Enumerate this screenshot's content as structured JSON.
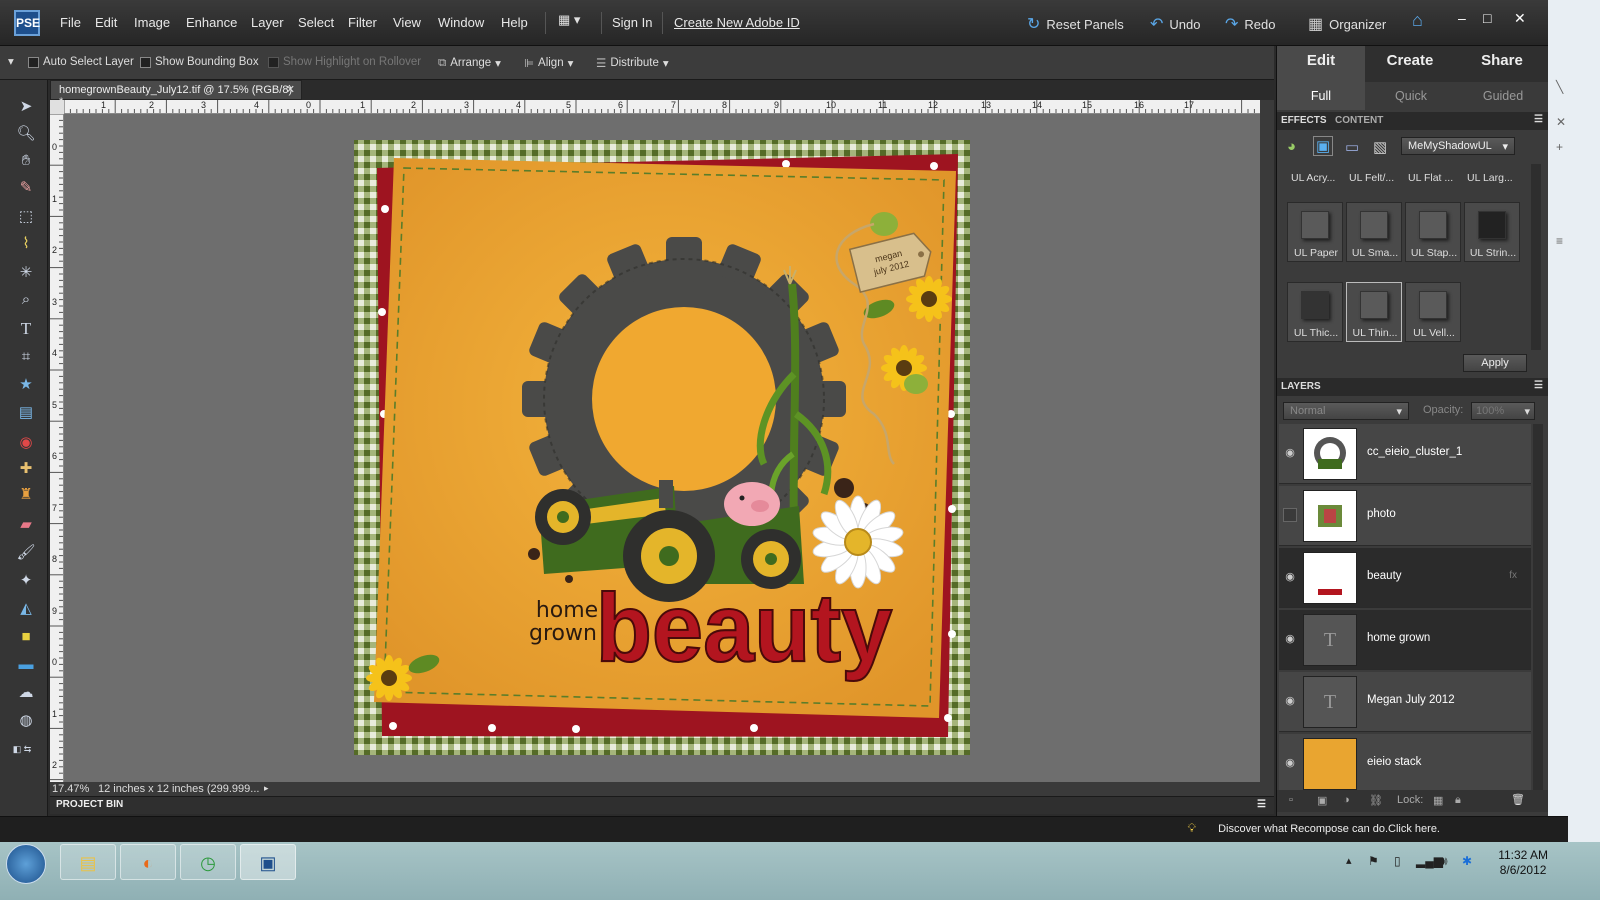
{
  "menubar": {
    "logo_text": "PSE",
    "items": [
      "File",
      "Edit",
      "Image",
      "Enhance",
      "Layer",
      "Select",
      "Filter",
      "View",
      "Window",
      "Help"
    ],
    "sign_in": "Sign In",
    "create_id": "Create New Adobe ID",
    "reset_panels": "Reset Panels",
    "undo": "Undo",
    "redo": "Redo",
    "organizer": "Organizer"
  },
  "options": {
    "auto_select": "Auto Select Layer",
    "show_bounding": "Show Bounding Box",
    "show_highlight": "Show Highlight on Rollover",
    "arrange": "Arrange",
    "align": "Align",
    "distribute": "Distribute"
  },
  "document": {
    "tab_title": "homegrownBeauty_July12.tif @ 17.5% (RGB/8) *",
    "zoom": "17.47%",
    "doc_info": "12 inches x 12 inches (299.999...",
    "project_bin": "PROJECT BIN",
    "ruler_h_labels": [
      "5",
      "6",
      "7",
      "8",
      "9",
      "10",
      "11",
      "12",
      "13",
      "14",
      "15",
      "16",
      "17"
    ],
    "ruler_h_labels_b": [
      "1",
      "2",
      "3",
      "4",
      "0",
      "1",
      "2",
      "3",
      "4"
    ],
    "ruler_v_labels": [
      "0",
      "1",
      "2",
      "3",
      "4",
      "5",
      "6",
      "7",
      "8",
      "9",
      "0",
      "1",
      "2"
    ]
  },
  "artwork": {
    "home_text": "home",
    "grown_text": "grown",
    "beauty_text": "beauty",
    "tag_line1": "megan",
    "tag_line2": "july 2012",
    "colors": {
      "paper": "#f0a830",
      "red_border": "#9e1420",
      "gingham": "#6f8a3c",
      "gear": "#4a4a48",
      "tractor": "#3f6b1e",
      "beauty": "#b3151f"
    }
  },
  "panel": {
    "modes": [
      "Edit",
      "Create",
      "Share"
    ],
    "submodes": [
      "Full",
      "Quick",
      "Guided"
    ],
    "effects_tab": "EFFECTS",
    "content_tab": "CONTENT",
    "style_dropdown": "MeMyShadowUL",
    "fx_row0": [
      "UL Acry...",
      "UL Felt/...",
      "UL Flat ...",
      "UL Larg..."
    ],
    "fx_row1": [
      "UL Paper",
      "UL Sma...",
      "UL Stap...",
      "UL Strin..."
    ],
    "fx_row2": [
      "UL Thic...",
      "UL Thin...",
      "UL Vell..."
    ],
    "apply": "Apply",
    "layers_head": "LAYERS",
    "blend_mode": "Normal",
    "opacity_label": "Opacity:",
    "opacity_value": "100%",
    "lock_label": "Lock:",
    "layers": [
      {
        "name": "cc_eieio_cluster_1",
        "visible": true,
        "selected": false,
        "kind": "cluster"
      },
      {
        "name": "photo",
        "visible": false,
        "selected": false,
        "kind": "photo"
      },
      {
        "name": "beauty",
        "visible": true,
        "selected": true,
        "kind": "beauty"
      },
      {
        "name": "home grown",
        "visible": true,
        "selected": true,
        "kind": "text"
      },
      {
        "name": "Megan July 2012",
        "visible": true,
        "selected": false,
        "kind": "text"
      },
      {
        "name": "eieio stack",
        "visible": true,
        "selected": false,
        "kind": "paper"
      }
    ]
  },
  "statusbar": {
    "tip": "Discover what Recompose can do.Click here."
  },
  "taskbar": {
    "time": "11:32 AM",
    "date": "8/6/2012"
  }
}
